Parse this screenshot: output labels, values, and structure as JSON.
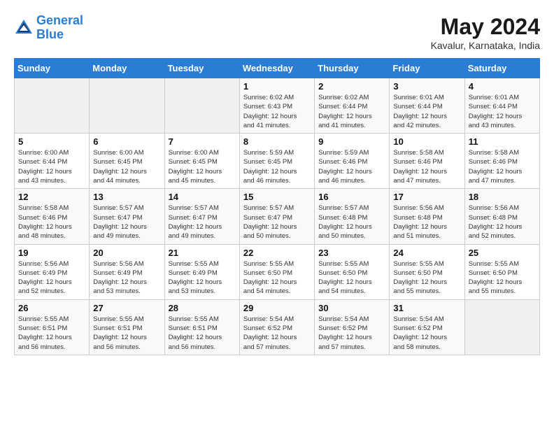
{
  "app": {
    "name": "GeneralBlue",
    "name_part1": "General",
    "name_part2": "Blue"
  },
  "header": {
    "month": "May 2024",
    "location": "Kavalur, Karnataka, India"
  },
  "days_of_week": [
    "Sunday",
    "Monday",
    "Tuesday",
    "Wednesday",
    "Thursday",
    "Friday",
    "Saturday"
  ],
  "weeks": [
    {
      "days": [
        {
          "num": "",
          "info": "",
          "empty": true
        },
        {
          "num": "",
          "info": "",
          "empty": true
        },
        {
          "num": "",
          "info": "",
          "empty": true
        },
        {
          "num": "1",
          "info": "Sunrise: 6:02 AM\nSunset: 6:43 PM\nDaylight: 12 hours\nand 41 minutes.",
          "empty": false
        },
        {
          "num": "2",
          "info": "Sunrise: 6:02 AM\nSunset: 6:44 PM\nDaylight: 12 hours\nand 41 minutes.",
          "empty": false
        },
        {
          "num": "3",
          "info": "Sunrise: 6:01 AM\nSunset: 6:44 PM\nDaylight: 12 hours\nand 42 minutes.",
          "empty": false
        },
        {
          "num": "4",
          "info": "Sunrise: 6:01 AM\nSunset: 6:44 PM\nDaylight: 12 hours\nand 43 minutes.",
          "empty": false
        }
      ]
    },
    {
      "days": [
        {
          "num": "5",
          "info": "Sunrise: 6:00 AM\nSunset: 6:44 PM\nDaylight: 12 hours\nand 43 minutes.",
          "empty": false
        },
        {
          "num": "6",
          "info": "Sunrise: 6:00 AM\nSunset: 6:45 PM\nDaylight: 12 hours\nand 44 minutes.",
          "empty": false
        },
        {
          "num": "7",
          "info": "Sunrise: 6:00 AM\nSunset: 6:45 PM\nDaylight: 12 hours\nand 45 minutes.",
          "empty": false
        },
        {
          "num": "8",
          "info": "Sunrise: 5:59 AM\nSunset: 6:45 PM\nDaylight: 12 hours\nand 46 minutes.",
          "empty": false
        },
        {
          "num": "9",
          "info": "Sunrise: 5:59 AM\nSunset: 6:46 PM\nDaylight: 12 hours\nand 46 minutes.",
          "empty": false
        },
        {
          "num": "10",
          "info": "Sunrise: 5:58 AM\nSunset: 6:46 PM\nDaylight: 12 hours\nand 47 minutes.",
          "empty": false
        },
        {
          "num": "11",
          "info": "Sunrise: 5:58 AM\nSunset: 6:46 PM\nDaylight: 12 hours\nand 47 minutes.",
          "empty": false
        }
      ]
    },
    {
      "days": [
        {
          "num": "12",
          "info": "Sunrise: 5:58 AM\nSunset: 6:46 PM\nDaylight: 12 hours\nand 48 minutes.",
          "empty": false
        },
        {
          "num": "13",
          "info": "Sunrise: 5:57 AM\nSunset: 6:47 PM\nDaylight: 12 hours\nand 49 minutes.",
          "empty": false
        },
        {
          "num": "14",
          "info": "Sunrise: 5:57 AM\nSunset: 6:47 PM\nDaylight: 12 hours\nand 49 minutes.",
          "empty": false
        },
        {
          "num": "15",
          "info": "Sunrise: 5:57 AM\nSunset: 6:47 PM\nDaylight: 12 hours\nand 50 minutes.",
          "empty": false
        },
        {
          "num": "16",
          "info": "Sunrise: 5:57 AM\nSunset: 6:48 PM\nDaylight: 12 hours\nand 50 minutes.",
          "empty": false
        },
        {
          "num": "17",
          "info": "Sunrise: 5:56 AM\nSunset: 6:48 PM\nDaylight: 12 hours\nand 51 minutes.",
          "empty": false
        },
        {
          "num": "18",
          "info": "Sunrise: 5:56 AM\nSunset: 6:48 PM\nDaylight: 12 hours\nand 52 minutes.",
          "empty": false
        }
      ]
    },
    {
      "days": [
        {
          "num": "19",
          "info": "Sunrise: 5:56 AM\nSunset: 6:49 PM\nDaylight: 12 hours\nand 52 minutes.",
          "empty": false
        },
        {
          "num": "20",
          "info": "Sunrise: 5:56 AM\nSunset: 6:49 PM\nDaylight: 12 hours\nand 53 minutes.",
          "empty": false
        },
        {
          "num": "21",
          "info": "Sunrise: 5:55 AM\nSunset: 6:49 PM\nDaylight: 12 hours\nand 53 minutes.",
          "empty": false
        },
        {
          "num": "22",
          "info": "Sunrise: 5:55 AM\nSunset: 6:50 PM\nDaylight: 12 hours\nand 54 minutes.",
          "empty": false
        },
        {
          "num": "23",
          "info": "Sunrise: 5:55 AM\nSunset: 6:50 PM\nDaylight: 12 hours\nand 54 minutes.",
          "empty": false
        },
        {
          "num": "24",
          "info": "Sunrise: 5:55 AM\nSunset: 6:50 PM\nDaylight: 12 hours\nand 55 minutes.",
          "empty": false
        },
        {
          "num": "25",
          "info": "Sunrise: 5:55 AM\nSunset: 6:50 PM\nDaylight: 12 hours\nand 55 minutes.",
          "empty": false
        }
      ]
    },
    {
      "days": [
        {
          "num": "26",
          "info": "Sunrise: 5:55 AM\nSunset: 6:51 PM\nDaylight: 12 hours\nand 56 minutes.",
          "empty": false
        },
        {
          "num": "27",
          "info": "Sunrise: 5:55 AM\nSunset: 6:51 PM\nDaylight: 12 hours\nand 56 minutes.",
          "empty": false
        },
        {
          "num": "28",
          "info": "Sunrise: 5:55 AM\nSunset: 6:51 PM\nDaylight: 12 hours\nand 56 minutes.",
          "empty": false
        },
        {
          "num": "29",
          "info": "Sunrise: 5:54 AM\nSunset: 6:52 PM\nDaylight: 12 hours\nand 57 minutes.",
          "empty": false
        },
        {
          "num": "30",
          "info": "Sunrise: 5:54 AM\nSunset: 6:52 PM\nDaylight: 12 hours\nand 57 minutes.",
          "empty": false
        },
        {
          "num": "31",
          "info": "Sunrise: 5:54 AM\nSunset: 6:52 PM\nDaylight: 12 hours\nand 58 minutes.",
          "empty": false
        },
        {
          "num": "",
          "info": "",
          "empty": true
        }
      ]
    }
  ]
}
